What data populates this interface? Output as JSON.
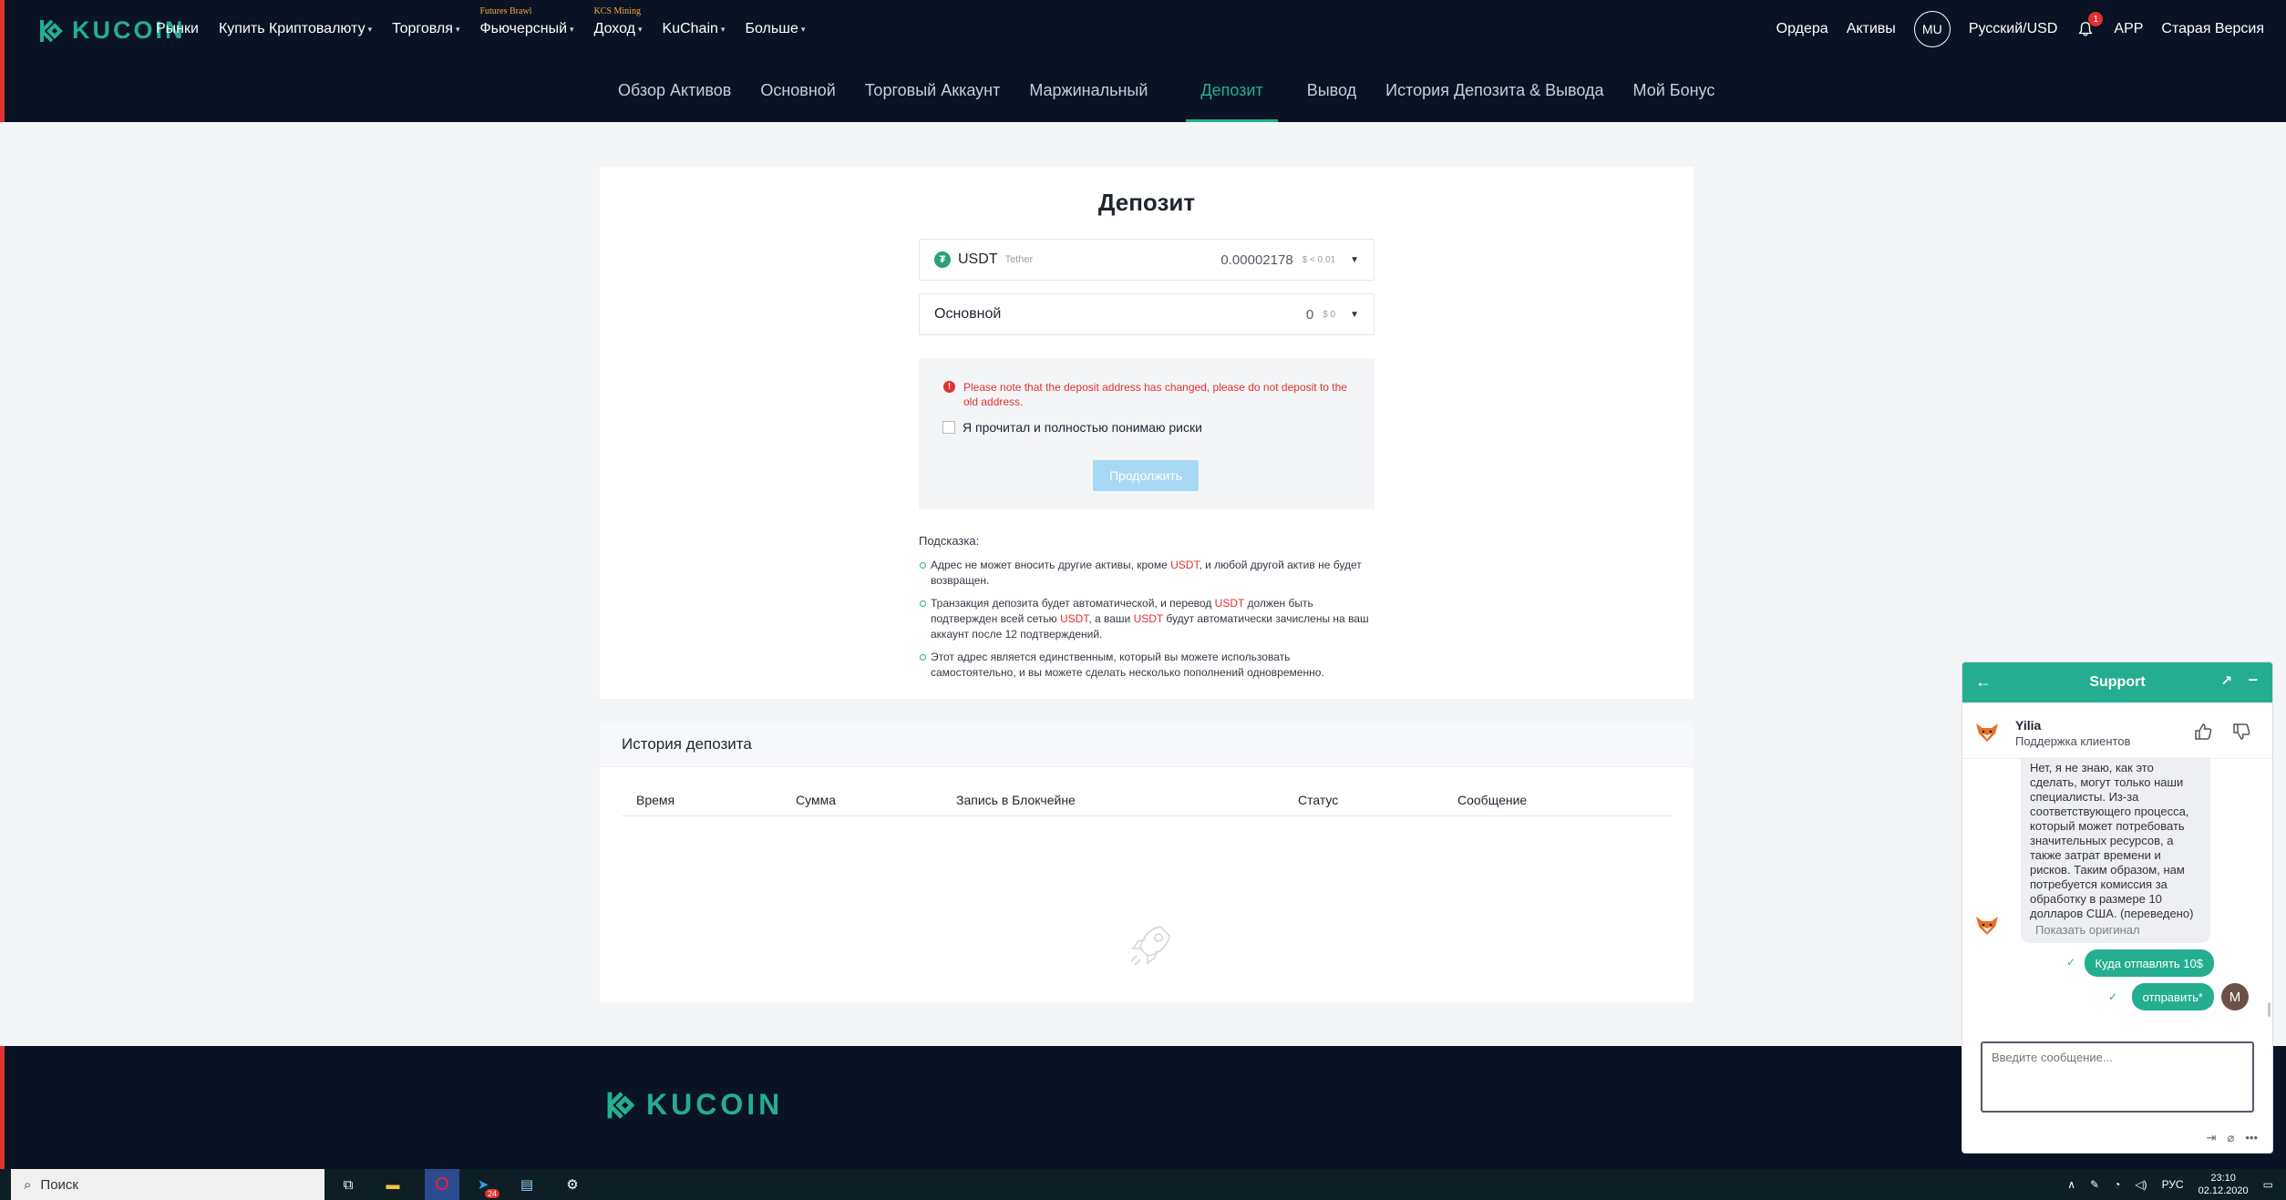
{
  "header": {
    "logo_text": "KUCOIN",
    "nav": [
      {
        "label": "Рынки",
        "caret": false,
        "sup": ""
      },
      {
        "label": "Купить Криптовалюту",
        "caret": true,
        "sup": ""
      },
      {
        "label": "Торговля",
        "caret": true,
        "sup": ""
      },
      {
        "label": "Фьючерсный",
        "caret": true,
        "sup": "Futures Brawl"
      },
      {
        "label": "Доход",
        "caret": true,
        "sup": "KCS Mining"
      },
      {
        "label": "KuChain",
        "caret": true,
        "sup": ""
      },
      {
        "label": "Больше",
        "caret": true,
        "sup": ""
      }
    ],
    "orders": "Ордера",
    "assets": "Активы",
    "avatar": "MU",
    "language": "Русский/USD",
    "notif_count": "1",
    "app": "APP",
    "old_version": "Старая Версия"
  },
  "subnav": {
    "items": [
      "Обзор Активов",
      "Основной",
      "Торговый Аккаунт",
      "Маржинальный",
      "Депозит",
      "Вывод",
      "История Депозита & Вывода",
      "Мой Бонус"
    ],
    "active": "Депозит"
  },
  "deposit": {
    "title": "Депозит",
    "coin": {
      "symbol": "USDT",
      "name": "Tether",
      "balance": "0.00002178",
      "usd": "$ < 0.01",
      "icon": "tether-icon"
    },
    "account": {
      "label": "Основной",
      "balance": "0",
      "usd": "$ 0"
    },
    "warning": "Please note that the deposit address has changed, please do not deposit to the old address.",
    "checkbox_label": "Я прочитал и полностью понимаю риски",
    "continue_button": "Продолжить",
    "hint_title": "Подсказка:",
    "hints": [
      {
        "a": "Адрес не может вносить другие активы, кроме ",
        "b": "USDT",
        "c": ", и любой другой актив не будет возвращен.",
        "d": "",
        "e": "",
        "f": "",
        "g": "",
        "h": ""
      },
      {
        "a": "Транзакция депозита будет автоматической, и перевод ",
        "b": "USDT",
        "c": " должен быть подтвержден всей сетью ",
        "d": "USDT",
        "e": ", а ваши ",
        "f": "USDT",
        "g": " будут автоматически зачислены на ваш аккаунт после 12 подтверждений.",
        "h": ""
      },
      {
        "a": "Этот адрес является единственным, который вы можете использовать самостоятельно, и вы можете сделать несколько пополнений одновременно.",
        "b": "",
        "c": "",
        "d": "",
        "e": "",
        "f": "",
        "g": "",
        "h": ""
      }
    ]
  },
  "history": {
    "title": "История депозита",
    "columns": [
      "Время",
      "Сумма",
      "Запись в Блокчейне",
      "Статус",
      "Сообщение"
    ]
  },
  "footer": {
    "logo_text": "KUCOIN"
  },
  "support": {
    "title": "Support",
    "agent_name": "Yilia",
    "agent_role": "Поддержка клиентов",
    "incoming": "Нет, я не знаю, как это сделать, могут только наши специалисты. Из-за соответствующего процесса, который может потребовать значительных ресурсов, а также затрат времени и рисков. Таким образом, нам потребуется комиссия за обработку в размере 10 долларов США. (переведено)",
    "show_original": "Показать оригинал",
    "outgoing": [
      "Куда отпавлять 10$",
      "отправить*"
    ],
    "user_initial": "M",
    "input_placeholder": "Введите сообщение..."
  },
  "taskbar": {
    "search_placeholder": "Поиск",
    "telegram_badge": "24",
    "lang": "РУС",
    "time": "23:10",
    "date": "02.12.2020"
  },
  "colors": {
    "accent": "#24ae8f",
    "nav_bg": "#091323",
    "danger": "#e0312f",
    "button_disabled": "#a7d8f4"
  }
}
